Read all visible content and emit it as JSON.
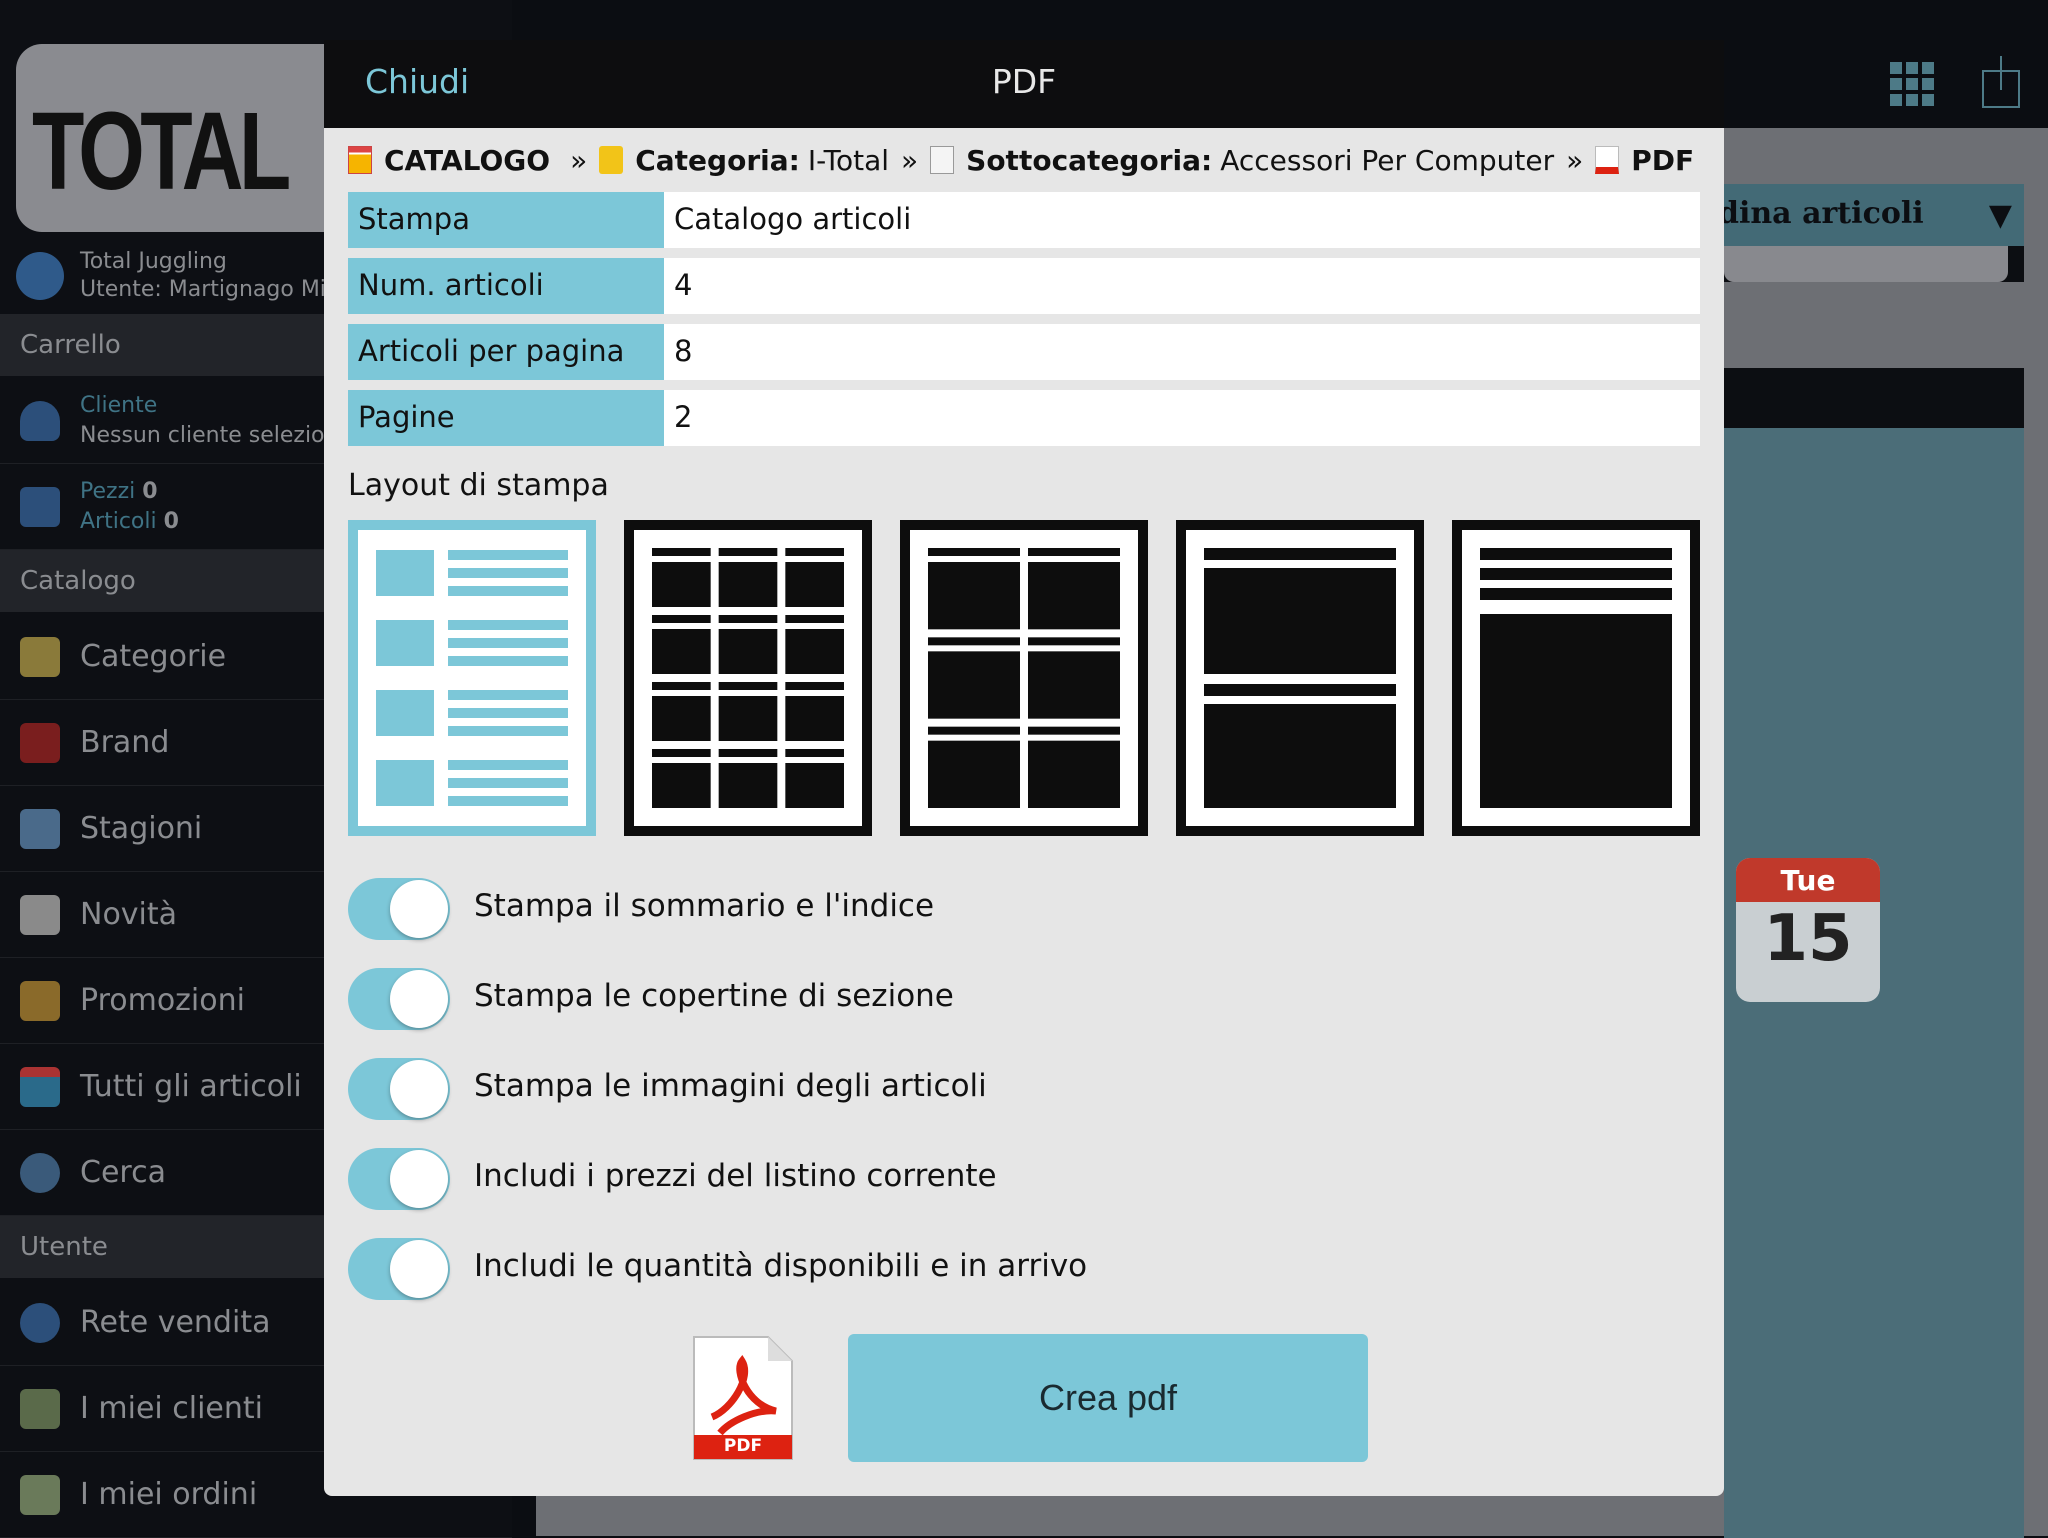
{
  "sidebar": {
    "logo_text": "TOTAL JUGGLING",
    "company": "Total Juggling",
    "user": "Utente: Martignago Mir",
    "cart_section": "Carrello",
    "client_label": "Cliente",
    "client_value": "Nessun cliente selezio",
    "pieces_label": "Pezzi",
    "pieces_value": "0",
    "articles_label": "Articoli",
    "articles_value": "0",
    "catalog_section": "Catalogo",
    "catalog_items": [
      "Categorie",
      "Brand",
      "Stagioni",
      "Novità",
      "Promozioni",
      "Tutti gli articoli",
      "Cerca"
    ],
    "user_section": "Utente",
    "user_items": [
      "Rete vendita",
      "I miei clienti",
      "I miei ordini"
    ]
  },
  "background": {
    "sort_label": "dina articoli",
    "calendar_day": "Tue",
    "calendar_date": "15"
  },
  "modal": {
    "close_label": "Chiudi",
    "title": "PDF",
    "breadcrumb": [
      {
        "bold": "CATALOGO",
        "text": ""
      },
      {
        "bold": "Categoria:",
        "text": "I-Total"
      },
      {
        "bold": "Sottocategoria:",
        "text": "Accessori Per Computer"
      },
      {
        "bold": "PDF",
        "text": ""
      }
    ],
    "breadcrumb_sep": "»",
    "fields": [
      {
        "label": "Stampa",
        "value": "Catalogo articoli"
      },
      {
        "label": "Num. articoli",
        "value": "4"
      },
      {
        "label": "Articoli per pagina",
        "value": "8"
      },
      {
        "label": "Pagine",
        "value": "2"
      }
    ],
    "layout_label": "Layout di stampa",
    "selected_layout": 1,
    "options": [
      {
        "label": "Stampa il sommario e l'indice",
        "on": true
      },
      {
        "label": "Stampa le copertine di sezione",
        "on": true
      },
      {
        "label": "Stampa le immagini degli articoli",
        "on": true
      },
      {
        "label": "Includi i prezzi del listino corrente",
        "on": true
      },
      {
        "label": "Includi le quantità disponibili e in arrivo",
        "on": true
      }
    ],
    "pdf_icon_text": "PDF",
    "create_label": "Crea pdf"
  },
  "colors": {
    "accent": "#7cc7d8",
    "header": "#0d0d0f",
    "panel": "#e6e6e6"
  }
}
